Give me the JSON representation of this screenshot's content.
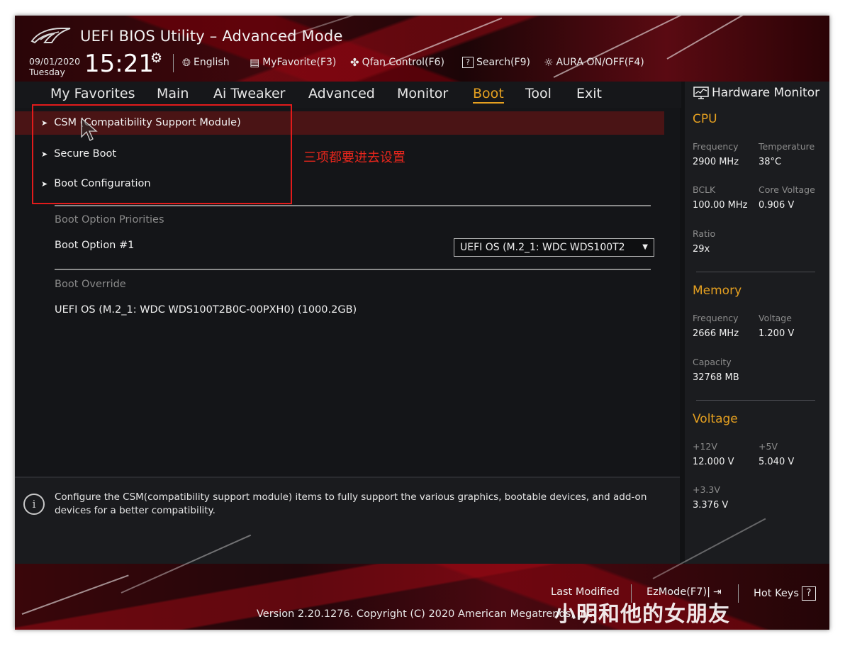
{
  "header": {
    "title": "UEFI BIOS Utility – Advanced Mode",
    "date": "09/01/2020",
    "day": "Tuesday",
    "time": "15:21",
    "toolbar": [
      {
        "label": "English",
        "icon": "globe-icon"
      },
      {
        "label": "MyFavorite(F3)",
        "icon": "favorite-list-icon"
      },
      {
        "label": "Qfan Control(F6)",
        "icon": "fan-icon"
      },
      {
        "label": "Search(F9)",
        "icon": "search-help-icon"
      },
      {
        "label": "AURA ON/OFF(F4)",
        "icon": "aura-light-icon"
      }
    ]
  },
  "tabs": [
    "My Favorites",
    "Main",
    "Ai Tweaker",
    "Advanced",
    "Monitor",
    "Boot",
    "Tool",
    "Exit"
  ],
  "active_tab": "Boot",
  "submenus": [
    "CSM (Compatibility Support Module)",
    "Secure Boot",
    "Boot Configuration"
  ],
  "annotation": "三项都要进去设置",
  "boot_priorities": {
    "section_label": "Boot Option Priorities",
    "option_label": "Boot Option #1",
    "option_value": "UEFI OS (M.2_1: WDC WDS100T2"
  },
  "boot_override": {
    "section_label": "Boot Override",
    "item": "UEFI OS (M.2_1: WDC WDS100T2B0C-00PXH0) (1000.2GB)"
  },
  "help_text": "Configure the CSM(compatibility support module) items to fully support the various graphics, bootable devices, and add-on devices for a better compatibility.",
  "hardware_monitor": {
    "title": "Hardware Monitor",
    "cpu": {
      "title": "CPU",
      "frequency_label": "Frequency",
      "frequency": "2900 MHz",
      "temperature_label": "Temperature",
      "temperature": "38°C",
      "bclk_label": "BCLK",
      "bclk": "100.00 MHz",
      "core_voltage_label": "Core Voltage",
      "core_voltage": "0.906 V",
      "ratio_label": "Ratio",
      "ratio": "29x"
    },
    "memory": {
      "title": "Memory",
      "frequency_label": "Frequency",
      "frequency": "2666 MHz",
      "voltage_label": "Voltage",
      "voltage": "1.200 V",
      "capacity_label": "Capacity",
      "capacity": "32768 MB"
    },
    "voltage": {
      "title": "Voltage",
      "v12_label": "+12V",
      "v12": "12.000 V",
      "v5_label": "+5V",
      "v5": "5.040 V",
      "v33_label": "+3.3V",
      "v33": "3.376 V"
    }
  },
  "footer": {
    "last_modified": "Last Modified",
    "ezmode": "EzMode(F7)|",
    "hotkeys": "Hot Keys",
    "copyright": "Version 2.20.1276. Copyright (C) 2020 American Megatrends, Inc.",
    "watermark": "小明和他的女朋友"
  },
  "colors": {
    "accent": "#e5a020",
    "highlight_row": "#4a1415",
    "annotation": "#e21b1b"
  }
}
